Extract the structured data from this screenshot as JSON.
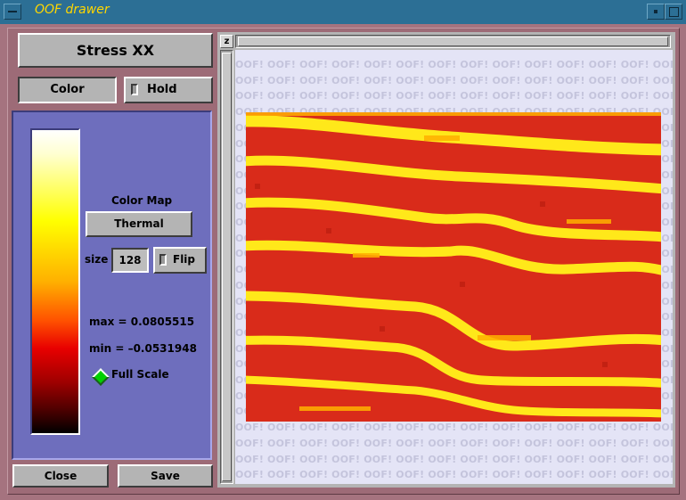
{
  "window": {
    "title": "OOF drawer"
  },
  "panel": {
    "quantity_label": "Stress XX",
    "color_button": "Color",
    "hold_button": "Hold",
    "colormap_label": "Color Map",
    "colormap_value": "Thermal",
    "size_label": "size",
    "size_value": "128",
    "flip_button": "Flip",
    "max_label": "max = 0.0805515",
    "min_label": "min = –0.0531948",
    "fullscale_label": "Full Scale",
    "fullscale_selected": true,
    "close_button": "Close",
    "save_button": "Save"
  },
  "canvas": {
    "z_button": "z",
    "watermark_text": "OOF!",
    "image_colors": [
      "#d92b1a",
      "#ffe81a",
      "#ffb000"
    ]
  },
  "colors": {
    "title_bar": "#2c6f95",
    "title_text": "#ffd700",
    "frame": "#9d6b77",
    "colormap_panel": "#6e6ebd",
    "button": "#b4b4b4",
    "canvas_background": "#e4e4f6"
  },
  "icons": {
    "window_menu": "window-menu-icon",
    "minimize": "minimize-icon",
    "maximize": "maximize-icon",
    "full_scale_radio": "diamond-radio-icon"
  }
}
